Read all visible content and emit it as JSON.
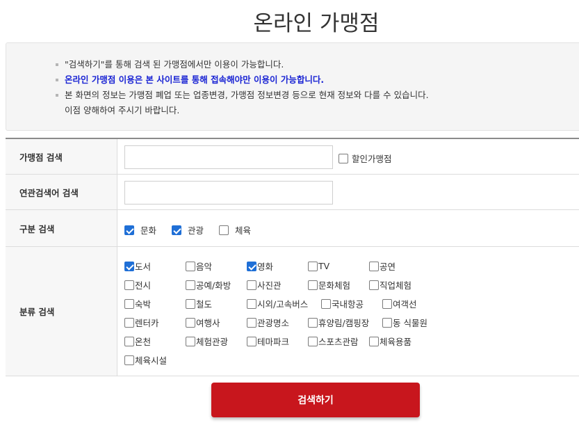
{
  "title": "온라인 가맹점",
  "notice": {
    "items": [
      {
        "text": "\"검색하기\"를 통해 검색 된 가맹점에서만 이용이 가능합니다.",
        "cont": ""
      },
      {
        "text": "온라인 가맹점 이용은 본 사이트를 통해 접속해야만 이용이 가능합니다.",
        "cont": ""
      },
      {
        "text": "본 화면의 정보는 가맹점 폐업 또는 업종변경, 가맹점 정보변경 등으로 현재 정보와 다를 수 있습니다.",
        "cont": "이점 양해하여 주시기 바랍니다."
      }
    ]
  },
  "form": {
    "store_search": {
      "label": "가맹점 검색",
      "value": "",
      "discount_label": "할인가맹점",
      "discount_checked": false
    },
    "related_search": {
      "label": "연관검색어 검색",
      "value": ""
    },
    "category": {
      "label": "구분 검색",
      "options": [
        {
          "label": "문화",
          "checked": true
        },
        {
          "label": "관광",
          "checked": true
        },
        {
          "label": "체육",
          "checked": false
        }
      ]
    },
    "classification": {
      "label": "분류 검색",
      "rows": [
        [
          {
            "label": "도서",
            "checked": true
          },
          {
            "label": "음악",
            "checked": false
          },
          {
            "label": "영화",
            "checked": true
          },
          {
            "label": "TV",
            "checked": false
          },
          {
            "label": "공연",
            "checked": false
          }
        ],
        [
          {
            "label": "전시",
            "checked": false
          },
          {
            "label": "공예/화방",
            "checked": false
          },
          {
            "label": "사진관",
            "checked": false
          },
          {
            "label": "문화체험",
            "checked": false
          },
          {
            "label": "직업체험",
            "checked": false
          }
        ],
        [
          {
            "label": "숙박",
            "checked": false
          },
          {
            "label": "철도",
            "checked": false
          },
          {
            "label": "시외/고속버스",
            "checked": false
          },
          {
            "label": "국내항공",
            "checked": false
          },
          {
            "label": "여객선",
            "checked": false
          }
        ],
        [
          {
            "label": "렌터카",
            "checked": false
          },
          {
            "label": "여행사",
            "checked": false
          },
          {
            "label": "관광명소",
            "checked": false
          },
          {
            "label": "휴양림/캠핑장",
            "checked": false
          },
          {
            "label": "동 식물원",
            "checked": false
          }
        ],
        [
          {
            "label": "온천",
            "checked": false
          },
          {
            "label": "체험관광",
            "checked": false
          },
          {
            "label": "테마파크",
            "checked": false
          },
          {
            "label": "스포츠관람",
            "checked": false
          },
          {
            "label": "체육용품",
            "checked": false
          }
        ],
        [
          {
            "label": "체육시설",
            "checked": false
          }
        ]
      ]
    }
  },
  "submit_label": "검색하기",
  "colors": {
    "accent_red": "#c8161d",
    "notice_blue": "#1a24d4",
    "check_blue": "#1f6fd6"
  }
}
